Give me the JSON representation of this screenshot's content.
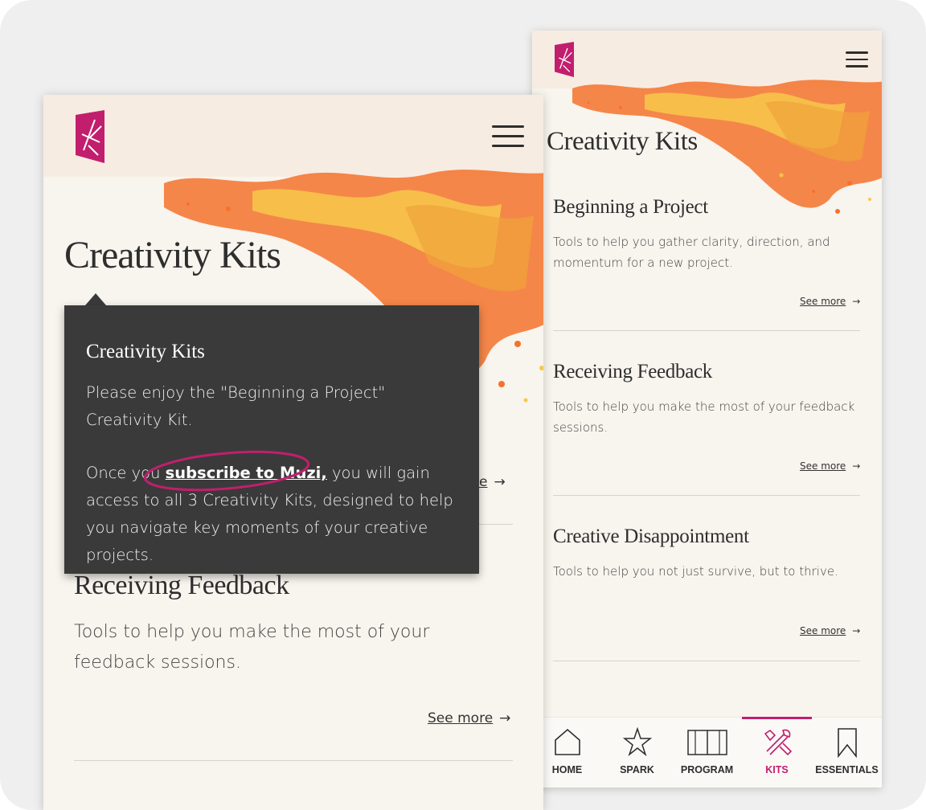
{
  "colors": {
    "brand": "#c21e6e",
    "background": "#f8f4ee",
    "tooltip": "#3a3a3a",
    "splash_orange": "#f4722b",
    "splash_yellow": "#f7c84a"
  },
  "icons": {
    "logo": "muzi-logo-icon",
    "menu": "hamburger-menu-icon",
    "arrow": "arrow-right-icon"
  },
  "back_screen": {
    "page_title": "Creativity Kits",
    "kits": [
      {
        "title": "Beginning a Project",
        "description": "Tools to help you gather clarity, direction, and momentum for a new project.",
        "see_more": "See more"
      },
      {
        "title": "Receiving Feedback",
        "description": "Tools to help you make the most of your feedback sessions.",
        "see_more": "See more"
      },
      {
        "title": "Creative Disappointment",
        "description": "Tools to help you not just survive, but to thrive.",
        "see_more": "See more"
      }
    ],
    "tabs": [
      {
        "label": "HOME",
        "icon": "home-icon",
        "active": false
      },
      {
        "label": "SPARK",
        "icon": "star-icon",
        "active": false
      },
      {
        "label": "PROGRAM",
        "icon": "book-icon",
        "active": false
      },
      {
        "label": "KITS",
        "icon": "tools-icon",
        "active": true
      },
      {
        "label": "ESSENTIALS",
        "icon": "bookmark-icon",
        "active": false
      }
    ]
  },
  "front_screen": {
    "page_title": "Creativity Kits",
    "kit_partial_see_more": "e",
    "kit_partial_arrow": "→",
    "kits": [
      {
        "title": "Receiving Feedback",
        "description": "Tools to help you make the most of your feedback sessions.",
        "see_more": "See more"
      }
    ],
    "tooltip": {
      "title": "Creativity Kits",
      "paragraph1": "Please enjoy the \"Beginning a Project\" Creativity Kit.",
      "paragraph2_before": "Once you ",
      "paragraph2_link": "subscribe to Muzi,",
      "paragraph2_after": " you will gain access to all 3 Creativity Kits, designed to help you navigate key moments of your creative projects."
    }
  }
}
